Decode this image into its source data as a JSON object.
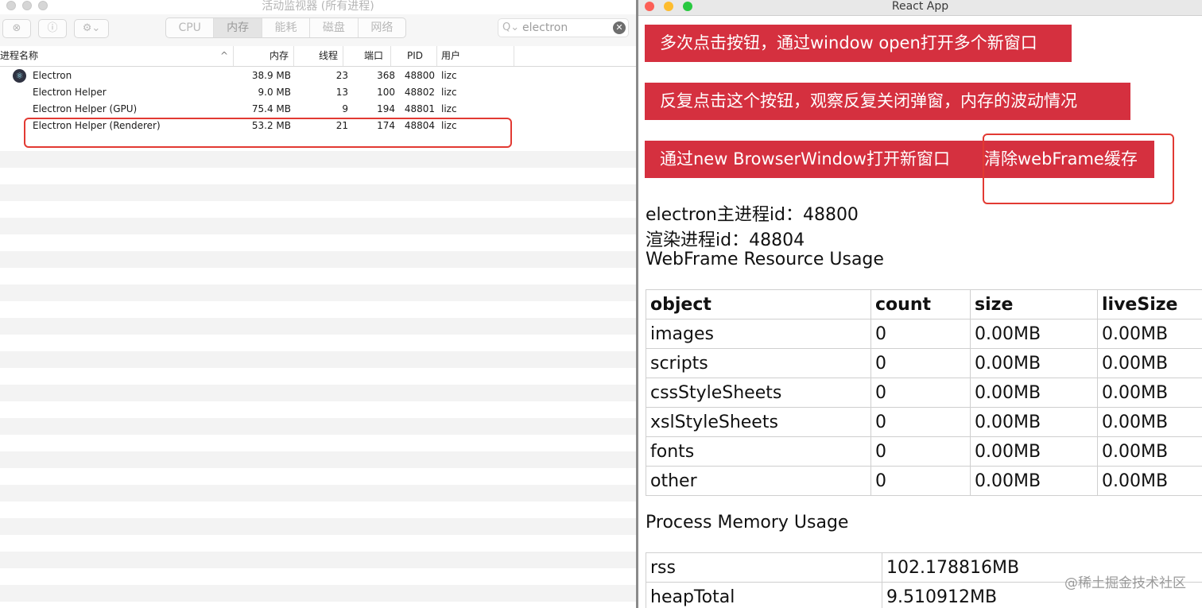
{
  "activity_monitor": {
    "title": "活动监视器 (所有进程)",
    "toolbar": {
      "close_icon": "⊗",
      "info_icon": "ⓘ",
      "gear_icon": "⚙︎⌄",
      "tabs": [
        {
          "label": "CPU"
        },
        {
          "label": "内存",
          "active": true
        },
        {
          "label": "能耗"
        },
        {
          "label": "磁盘"
        },
        {
          "label": "网络"
        }
      ],
      "search_value": "electron",
      "search_icon": "Q⌄",
      "clear_icon": "✕"
    },
    "columns": {
      "name": "进程名称",
      "sort_icon": "^",
      "memory": "内存",
      "threads": "线程",
      "ports": "端口",
      "pid": "PID",
      "user": "用户"
    },
    "rows": [
      {
        "name": "Electron",
        "memory": "38.9 MB",
        "threads": "23",
        "ports": "368",
        "pid": "48800",
        "user": "lizc"
      },
      {
        "name": "Electron Helper",
        "memory": "9.0 MB",
        "threads": "13",
        "ports": "100",
        "pid": "48802",
        "user": "lizc"
      },
      {
        "name": "Electron Helper (GPU)",
        "memory": "75.4 MB",
        "threads": "9",
        "ports": "194",
        "pid": "48801",
        "user": "lizc"
      },
      {
        "name": "Electron Helper (Renderer)",
        "memory": "53.2 MB",
        "threads": "21",
        "ports": "174",
        "pid": "48804",
        "user": "lizc"
      }
    ],
    "electron_icon": "⚛"
  },
  "react_app": {
    "title": "React App",
    "buttons": {
      "open_multiple": "多次点击按钮，通过window open打开多个新窗口",
      "repeat_close": "反复点击这个按钮，观察反复关闭弹窗，内存的波动情况",
      "new_browser_window": "通过new BrowserWindow打开新窗口",
      "clear_cache": "清除webFrame缓存"
    },
    "main_pid_text": "electron主进程id：48800",
    "renderer_pid_text": "渲染进程id：48804",
    "webframe_heading": "WebFrame Resource Usage",
    "webframe_table": {
      "headers": [
        "object",
        "count",
        "size",
        "liveSize"
      ],
      "rows": [
        [
          "images",
          "0",
          "0.00MB",
          "0.00MB"
        ],
        [
          "scripts",
          "0",
          "0.00MB",
          "0.00MB"
        ],
        [
          "cssStyleSheets",
          "0",
          "0.00MB",
          "0.00MB"
        ],
        [
          "xslStyleSheets",
          "0",
          "0.00MB",
          "0.00MB"
        ],
        [
          "fonts",
          "0",
          "0.00MB",
          "0.00MB"
        ],
        [
          "other",
          "0",
          "0.00MB",
          "0.00MB"
        ]
      ]
    },
    "process_heading": "Process Memory Usage",
    "process_table": {
      "rows": [
        [
          "rss",
          "102.178816MB"
        ],
        [
          "heapTotal",
          "9.510912MB"
        ]
      ]
    }
  },
  "watermark": "@稀土掘金技术社区",
  "colors": {
    "accent_button": "#d5303f",
    "highlight_border": "#e23a33"
  }
}
